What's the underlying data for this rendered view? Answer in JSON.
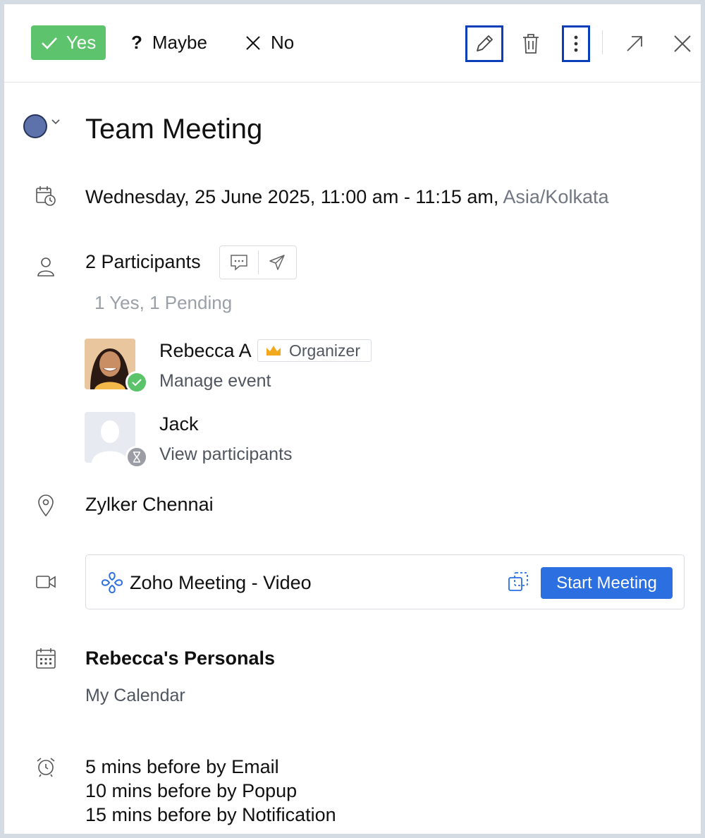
{
  "toolbar": {
    "yes_label": "Yes",
    "maybe_glyph": "?",
    "maybe_label": "Maybe",
    "no_label": "No"
  },
  "event": {
    "title": "Team Meeting",
    "color": "#5d72aa",
    "datetime": "Wednesday, 25 June 2025,  11:00 am  - 11:15 am,",
    "timezone": "Asia/Kolkata"
  },
  "participants": {
    "count_label": "2 Participants",
    "summary": "1 Yes, 1 Pending",
    "people": [
      {
        "name": "Rebecca A",
        "badge": "Organizer",
        "link": "Manage event",
        "status": "yes"
      },
      {
        "name": "Jack",
        "link": "View participants",
        "status": "pending"
      }
    ]
  },
  "location": "Zylker Chennai",
  "meeting": {
    "provider": "Zoho Meeting - Video",
    "start_label": "Start Meeting"
  },
  "calendar": {
    "name": "Rebecca's Personals",
    "sub": "My Calendar"
  },
  "reminders": [
    "5 mins before by Email",
    "10 mins before by Popup",
    "15 mins before by Notification"
  ],
  "colors": {
    "yes_green": "#5dc46d",
    "primary_blue": "#2b6fe0",
    "highlight_border": "#0a3fb8"
  }
}
